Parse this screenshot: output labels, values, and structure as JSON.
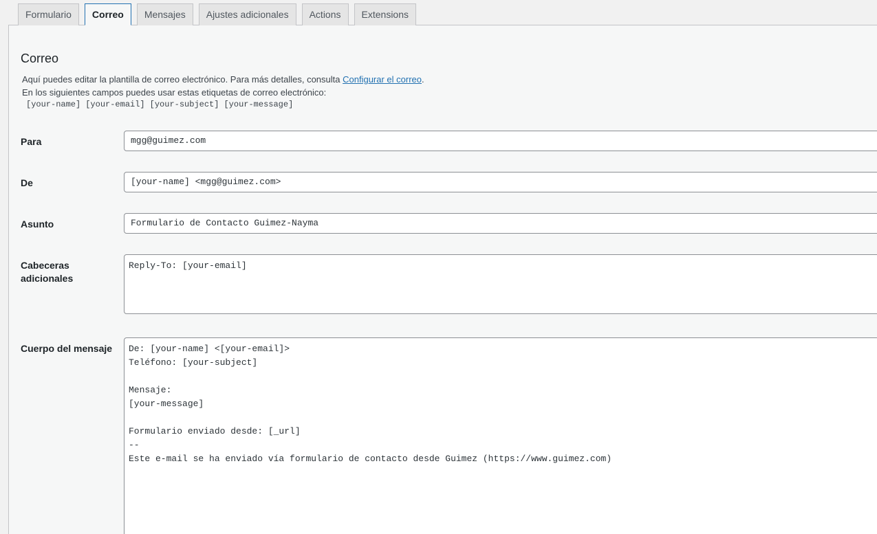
{
  "tabs": [
    {
      "label": "Formulario"
    },
    {
      "label": "Correo"
    },
    {
      "label": "Mensajes"
    },
    {
      "label": "Ajustes adicionales"
    },
    {
      "label": "Actions"
    },
    {
      "label": "Extensions"
    }
  ],
  "active_tab": "Correo",
  "section": {
    "title": "Correo",
    "desc_line1_pre": "Aquí puedes editar la plantilla de correo electrónico. Para más detalles, consulta ",
    "desc_link": "Configurar el correo",
    "desc_line1_post": ".",
    "desc_line2": "En los siguientes campos puedes usar estas etiquetas de correo electrónico:",
    "tags": [
      "[your-name]",
      "[your-email]",
      "[your-subject]",
      "[your-message]"
    ]
  },
  "fields": {
    "to": {
      "label": "Para",
      "value": "mgg@guimez.com"
    },
    "from": {
      "label": "De",
      "value": "[your-name] <mgg@guimez.com>"
    },
    "subject": {
      "label": "Asunto",
      "value": "Formulario de Contacto Guimez-Nayma"
    },
    "headers": {
      "label_line1": "Cabeceras",
      "label_line2": "adicionales",
      "value": "Reply-To: [your-email]"
    },
    "body": {
      "label": "Cuerpo del mensaje",
      "value": "De: [your-name] <[your-email]>\nTeléfono: [your-subject]\n\nMensaje:\n[your-message]\n\nFormulario enviado desde: [_url]\n--\nEste e-mail se ha enviado vía formulario de contacto desde Guimez (https://www.guimez.com)"
    }
  }
}
